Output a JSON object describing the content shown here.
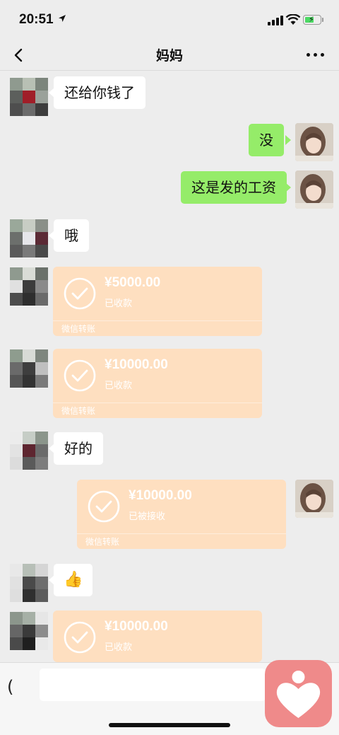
{
  "status_bar": {
    "time": "20:51"
  },
  "header": {
    "title": "妈妈"
  },
  "messages": [
    {
      "type": "text",
      "side": "in",
      "text": "还给你钱了"
    },
    {
      "type": "text",
      "side": "out",
      "text": "没"
    },
    {
      "type": "text",
      "side": "out",
      "text": "这是发的工资"
    },
    {
      "type": "text",
      "side": "in",
      "text": "哦"
    },
    {
      "type": "transfer",
      "side": "in",
      "amount": "¥5000.00",
      "status": "已收款",
      "footer": "微信转账"
    },
    {
      "type": "transfer",
      "side": "in",
      "amount": "¥10000.00",
      "status": "已收款",
      "footer": "微信转账"
    },
    {
      "type": "text",
      "side": "in",
      "text": "好的"
    },
    {
      "type": "transfer",
      "side": "out",
      "amount": "¥10000.00",
      "status": "已被接收",
      "footer": "微信转账"
    },
    {
      "type": "emoji",
      "side": "in",
      "text": "👍"
    },
    {
      "type": "transfer",
      "side": "in",
      "amount": "¥10000.00",
      "status": "已收款"
    }
  ],
  "input": {
    "placeholder": ""
  },
  "colors": {
    "background": "#ededed",
    "bubble_out": "#95ec69",
    "bubble_in": "#ffffff",
    "transfer_card": "#fedfc0",
    "app_icon": "#ef8a8a"
  },
  "icons": [
    "back-icon",
    "more-icon",
    "check-icon",
    "voice-icon",
    "heart-app-icon",
    "location-arrow-icon",
    "signal-icon",
    "wifi-icon",
    "battery-icon"
  ]
}
